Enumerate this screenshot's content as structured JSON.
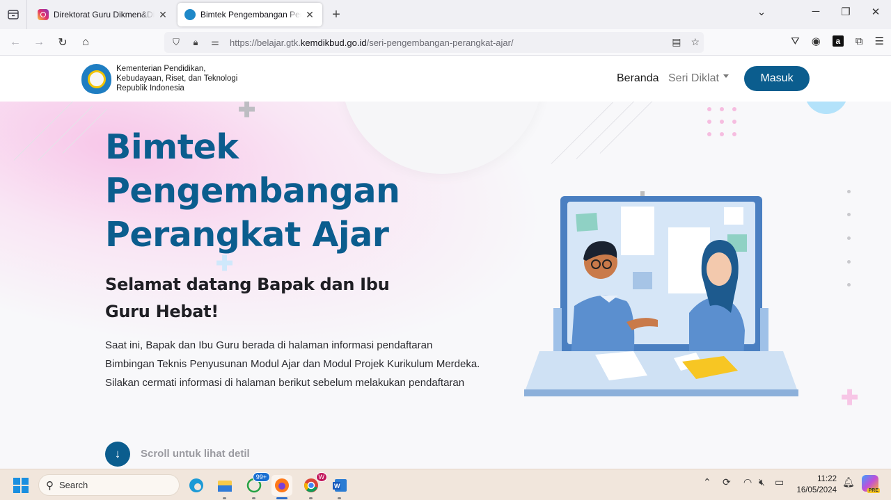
{
  "browser": {
    "tabs": [
      {
        "title": "Direktorat Guru Dikmen&Diksus",
        "favicon": "instagram-icon",
        "active": false
      },
      {
        "title": "Bimtek Pengembangan Perangkat Ajar",
        "favicon": "kemdikbud-icon",
        "active": true
      }
    ],
    "url_prefix": "https://belajar.gtk.",
    "url_domain": "kemdikbud.go.id",
    "url_path": "/seri-pengembangan-perangkat-ajar/"
  },
  "site": {
    "org_lines": [
      "Kementerian Pendidikan,",
      "Kebudayaan, Riset, dan Teknologi",
      "Republik Indonesia"
    ],
    "nav": {
      "home": "Beranda",
      "series": "Seri Diklat",
      "login": "Masuk"
    },
    "hero": {
      "title": "Bimtek Pengembangan Perangkat Ajar",
      "greeting": "Selamat datang Bapak dan Ibu Guru Hebat!",
      "description": "Saat ini, Bapak dan Ibu Guru berada di halaman informasi pendaftaran Bimbingan Teknis Penyusunan Modul Ajar dan Modul Projek Kurikulum Merdeka. Silakan cermati informasi di halaman berikut sebelum melakukan pendaftaran",
      "scroll_label": "Scroll untuk lihat detil"
    },
    "colors": {
      "primary": "#0b5d8e",
      "text": "#1f1f24",
      "muted": "#9a9aa0"
    }
  },
  "taskbar": {
    "search_placeholder": "Search",
    "whatsapp_badge": "99+",
    "chrome_badge": "W",
    "time": "11:22",
    "date": "16/05/2024",
    "copilot_label": "PRE"
  }
}
